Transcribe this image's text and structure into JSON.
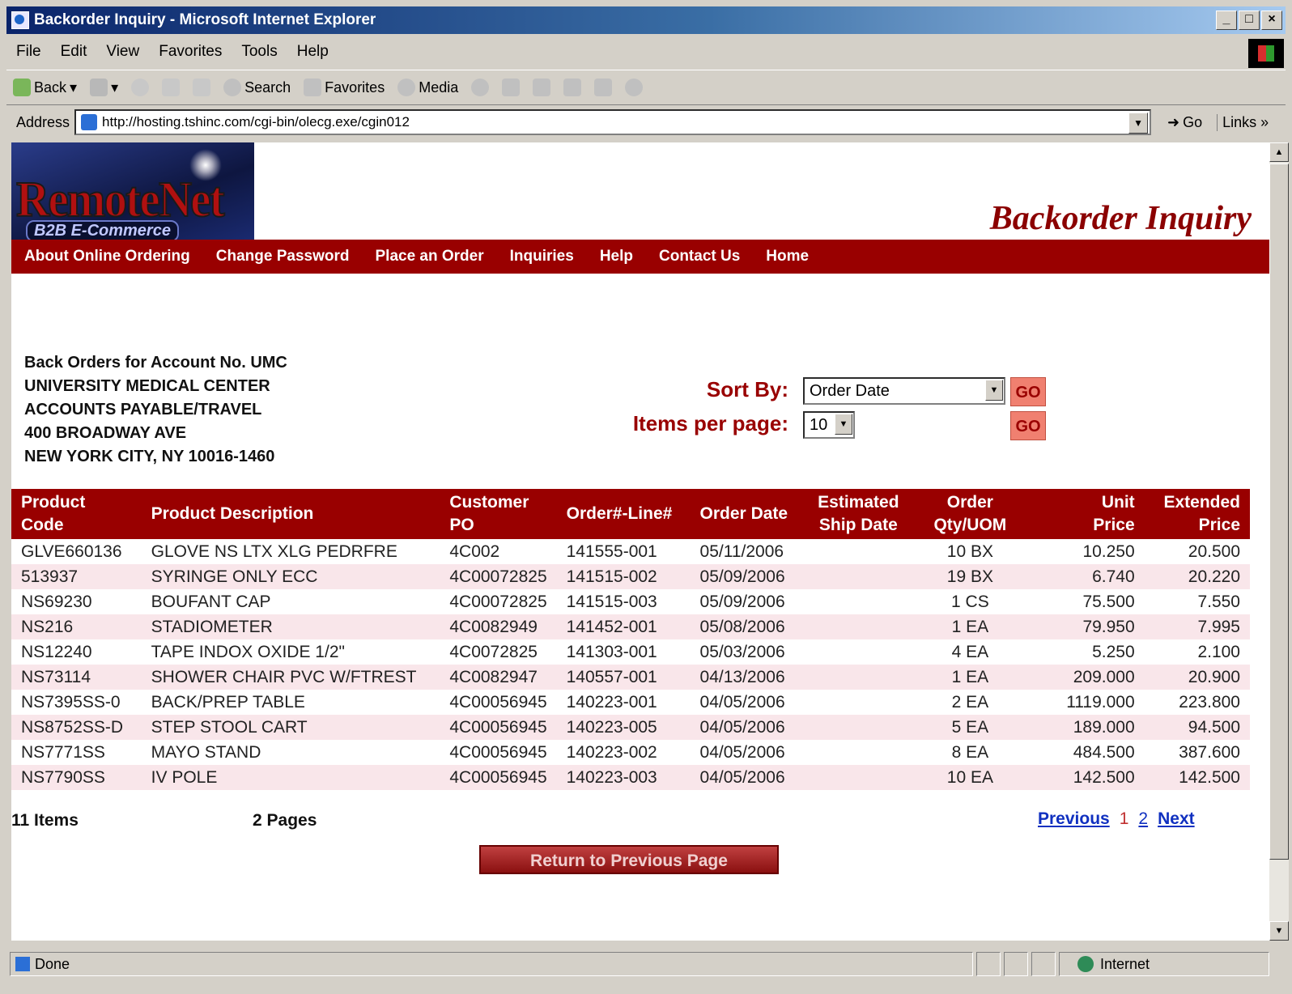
{
  "window": {
    "title": "Backorder Inquiry - Microsoft Internet Explorer",
    "controls": [
      "_",
      "□",
      "×"
    ]
  },
  "menu": [
    "File",
    "Edit",
    "View",
    "Favorites",
    "Tools",
    "Help"
  ],
  "toolbar": {
    "back": "Back",
    "search": "Search",
    "favorites": "Favorites",
    "media": "Media"
  },
  "address": {
    "label": "Address",
    "url": "http://hosting.tshinc.com/cgi-bin/olecg.exe/cgin012",
    "go": "Go",
    "links": "Links »"
  },
  "page": {
    "logo_main": "RemoteNet",
    "logo_sub": "B2B E-Commerce",
    "heading": "Backorder Inquiry",
    "nav": [
      "About Online Ordering",
      "Change Password",
      "Place an Order",
      "Inquiries",
      "Help",
      "Contact Us",
      "Home"
    ],
    "account": {
      "line1": "Back Orders for Account No. UMC",
      "line2": "UNIVERSITY MEDICAL CENTER",
      "line3": "ACCOUNTS PAYABLE/TRAVEL",
      "line4": "400 BROADWAY AVE",
      "line5": "NEW YORK CITY, NY 10016-1460"
    },
    "sort": {
      "label": "Sort By:",
      "value": "Order Date",
      "go": "GO"
    },
    "ipp": {
      "label": "Items per page:",
      "value": "10",
      "go": "GO"
    },
    "table": {
      "headers": [
        "Product\nCode",
        "Product Description",
        "Customer\nPO",
        "Order#-Line#",
        "Order Date",
        "Estimated\nShip Date",
        "Order\nQty/UOM",
        "Unit\nPrice",
        "Extended\nPrice"
      ],
      "rows": [
        [
          "GLVE660136",
          "GLOVE NS LTX XLG PEDRFRE",
          "4C002",
          "141555-001",
          "05/11/2006",
          "",
          "10 BX",
          "10.250",
          "20.500"
        ],
        [
          "513937",
          "SYRINGE ONLY ECC",
          "4C00072825",
          "141515-002",
          "05/09/2006",
          "",
          "19 BX",
          "6.740",
          "20.220"
        ],
        [
          "NS69230",
          "BOUFANT CAP",
          "4C00072825",
          "141515-003",
          "05/09/2006",
          "",
          "1 CS",
          "75.500",
          "7.550"
        ],
        [
          "NS216",
          "STADIOMETER",
          "4C0082949",
          "141452-001",
          "05/08/2006",
          "",
          "1 EA",
          "79.950",
          "7.995"
        ],
        [
          "NS12240",
          "TAPE INDOX OXIDE 1/2\"",
          "4C0072825",
          "141303-001",
          "05/03/2006",
          "",
          "4 EA",
          "5.250",
          "2.100"
        ],
        [
          "NS73114",
          "SHOWER CHAIR PVC W/FTREST",
          "4C0082947",
          "140557-001",
          "04/13/2006",
          "",
          "1 EA",
          "209.000",
          "20.900"
        ],
        [
          "NS7395SS-0",
          "BACK/PREP TABLE",
          "4C00056945",
          "140223-001",
          "04/05/2006",
          "",
          "2 EA",
          "1119.000",
          "223.800"
        ],
        [
          "NS8752SS-D",
          "STEP STOOL CART",
          "4C00056945",
          "140223-005",
          "04/05/2006",
          "",
          "5 EA",
          "189.000",
          "94.500"
        ],
        [
          "NS7771SS",
          "MAYO STAND",
          "4C00056945",
          "140223-002",
          "04/05/2006",
          "",
          "8 EA",
          "484.500",
          "387.600"
        ],
        [
          "NS7790SS",
          "IV POLE",
          "4C00056945",
          "140223-003",
          "04/05/2006",
          "",
          "10 EA",
          "142.500",
          "142.500"
        ]
      ]
    },
    "items_count": "11 Items",
    "pages_count": "2 Pages",
    "pager": {
      "prev": "Previous",
      "p1": "1",
      "p2": "2",
      "next": "Next"
    },
    "return_button": "Return to Previous Page"
  },
  "status": {
    "text": "Done",
    "zone": "Internet"
  }
}
